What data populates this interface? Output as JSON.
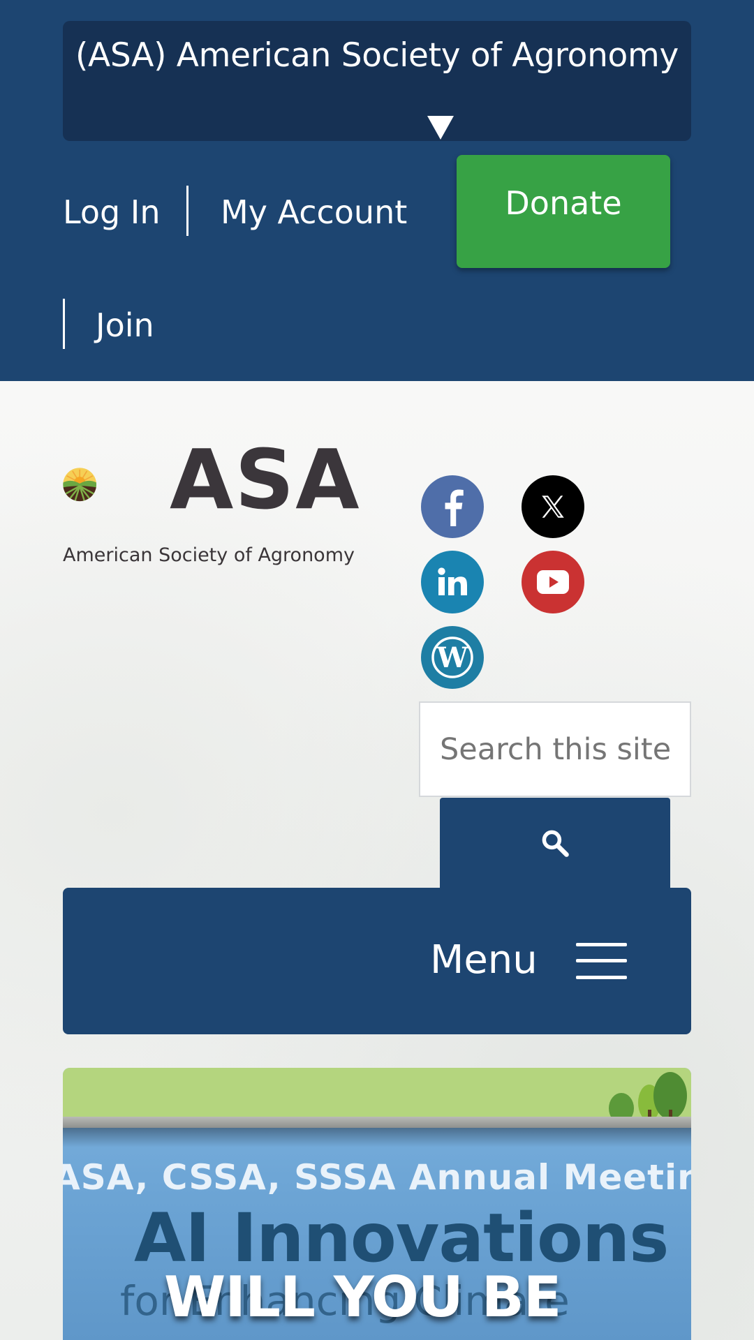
{
  "header": {
    "society_selector": "(ASA) American Society of Agronomy",
    "login_label": "Log In",
    "account_label": "My Account",
    "join_label": "Join",
    "donate_label": "Donate"
  },
  "logo": {
    "abbr": "ASA",
    "full_name": "American Society of Agronomy"
  },
  "social": {
    "icons": [
      "facebook-icon",
      "x-twitter-icon",
      "linkedin-icon",
      "youtube-icon",
      "wordpress-icon"
    ]
  },
  "search": {
    "placeholder": "Search this site"
  },
  "menu": {
    "label": "Menu"
  },
  "banner": {
    "meeting_line": "ASA, CSSA, SSSA Annual Meeting",
    "title": "AI Innovations",
    "subtitle": "for Enhancing Climate",
    "cta": "WILL YOU BE"
  },
  "colors": {
    "brand_navy": "#1d4571",
    "donate_green": "#37a245"
  }
}
